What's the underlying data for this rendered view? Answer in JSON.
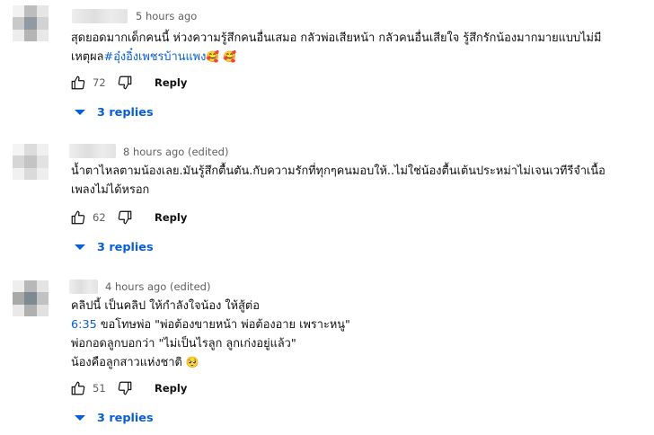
{
  "comments": [
    {
      "time": "5 hours ago",
      "lines": [
        [
          {
            "t": "สุดยอดมากเด็กคนนี้ ห่วงความรู้สึกคนอื่นเสมอ กลัวพ่อเสียหน้า กลัวคนอื่นเสียใจ รู้สึกรักน้องมากมายแบบไม่มี"
          }
        ],
        [
          {
            "t": "เหตุผล"
          },
          {
            "t": "#อุ๋งอิ๋งเพชรบ้านแพง",
            "link": true
          },
          {
            "t": "🥰 🥰",
            "emoji": true
          }
        ]
      ],
      "likes": "72",
      "reply_label": "Reply",
      "replies_label": "3 replies",
      "avatar_colors": [
        "#f2f2f2",
        "#bdbdbd",
        "#e6e6e6",
        "#c9c9c9",
        "#8f9aa3",
        "#d2d2d2",
        "#ededed",
        "#b5b5b5",
        "#e8e8e8"
      ]
    },
    {
      "time": "8 hours ago (edited)",
      "lines": [
        [
          {
            "t": "น้ำตาไหลตามน้องเลย.มันรู้สึกตื้นตัน.กับความรักที่ทุกๆคนมอบให้..ไม่ใช่น้องตื้นเต้นประหม่าไม่เจนเวทีรีจำเนื้อ"
          }
        ],
        [
          {
            "t": "เพลงไม่ได้หรอก"
          }
        ]
      ],
      "likes": "62",
      "reply_label": "Reply",
      "replies_label": "3 replies",
      "avatar_colors": [
        "#f4f4f4",
        "#dcdcdc",
        "#f0f0f0",
        "#d6d6d6",
        "#c4c4c4",
        "#e2e2e2",
        "#f1f1f1",
        "#dadada",
        "#eeeeee"
      ]
    },
    {
      "time": "4 hours ago (edited)",
      "lines": [
        [
          {
            "t": "คลิปนี้ เป็นคลิป ให้กำลังใจน้อง ให้สู้ต่อ"
          }
        ],
        [
          {
            "t": "6:35",
            "link": true
          },
          {
            "t": " ขอโทษพ่อ \"พ่อต้องขายหน้า พ่อต้องอาย เพราะหนู\""
          }
        ],
        [
          {
            "t": "พ่อกอดลูกบอกว่า \"ไม่เป็นไรลูก ลูกเก่งอยู่แล้ว\""
          }
        ],
        [
          {
            "t": "น้องคือลูกสาวแห่งชาติ "
          },
          {
            "t": "🥺",
            "emoji": true
          }
        ]
      ],
      "likes": "51",
      "reply_label": "Reply",
      "replies_label": "3 replies",
      "avatar_colors": [
        "#eeeeee",
        "#b8b8b8",
        "#e4e4e4",
        "#a9a9a9",
        "#7d8a91",
        "#c2c2c2",
        "#e9e9e9",
        "#b0b0b0",
        "#e1e1e1"
      ]
    }
  ],
  "colors": {
    "link": "#065fd4",
    "meta": "#606060",
    "text": "#0f0f0f"
  }
}
